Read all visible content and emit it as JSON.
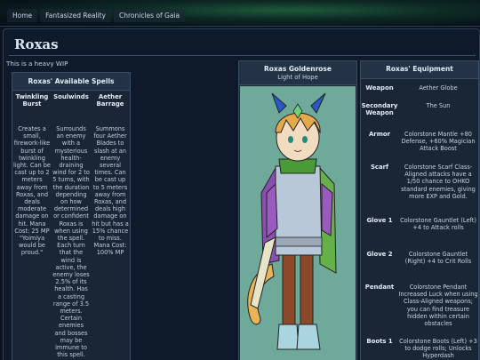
{
  "breadcrumbs": [
    "Home",
    "Fantasized Reality",
    "Chronicles of Gaia"
  ],
  "page": {
    "title": "Roxas",
    "note": "This is a heavy WIP"
  },
  "spells": {
    "heading": "Roxas' Available Spells",
    "items": [
      {
        "name": "Twinkling Burst",
        "description": "Creates a small, firework-like burst of twinkling light. Can be cast up to 2 meters away from Roxas, and deals moderate damage on hit. Mana Cost: 25 MP \"Yoimiya would be proud.\""
      },
      {
        "name": "Soulwinds",
        "description": "Surrounds an enemy with a mysterious health-draining wind for 2 to 5 turns, with the duration depending on how determined or confident Roxas is when using the spell. Each turn that the wind is active, the enemy loses 2.5% of its health. Has a casting range of 3.5 meters. Certain enemies and bosses may be immune to this spell. Mana Cost:"
      },
      {
        "name": "Aether Barrage",
        "description": "Summons four Aether Blades to slash at an enemy several times. Can be cast up to 5 meters away from Roxas, and deals high damage on hit but has a 15% chance to miss. Mana Cost: 100% MP"
      }
    ]
  },
  "character": {
    "name": "Roxas Goldenrose",
    "subtitle": "Light of Hope"
  },
  "equipment": {
    "heading": "Roxas' Equipment",
    "rows": [
      {
        "label": "Weapon",
        "value": "Aether Globe"
      },
      {
        "label": "Secondary Weapon",
        "value": "The Sun"
      },
      {
        "label": "Armor",
        "value": "Colorstone Mantle +80 Defense, +60% Magician Attack Boost"
      },
      {
        "label": "Scarf",
        "value": "Colorstone Scarf Class-Aligned attacks have a 1/50 chance to OHKO standard enemies, giving more EXP and Gold."
      },
      {
        "label": "Glove 1",
        "value": "Colorstone Gauntlet (Left) +4 to Attack rolls"
      },
      {
        "label": "Glove 2",
        "value": "Colorstone Gauntlet (Right) +4 to Crit Rolls"
      },
      {
        "label": "Pendant",
        "value": "Colorstone Pendant Increased Luck when using Class-Aligned weapons; you can find treasure hidden within certain obstacles"
      },
      {
        "label": "Boots 1",
        "value": "Colorstone Boots (Left) +3 to dodge rolls; Unlocks Hyperdash"
      }
    ]
  },
  "colors": {
    "background": "#0e1a2a",
    "panel": "#1a2535",
    "portrait_bg": "#6fa99a"
  }
}
